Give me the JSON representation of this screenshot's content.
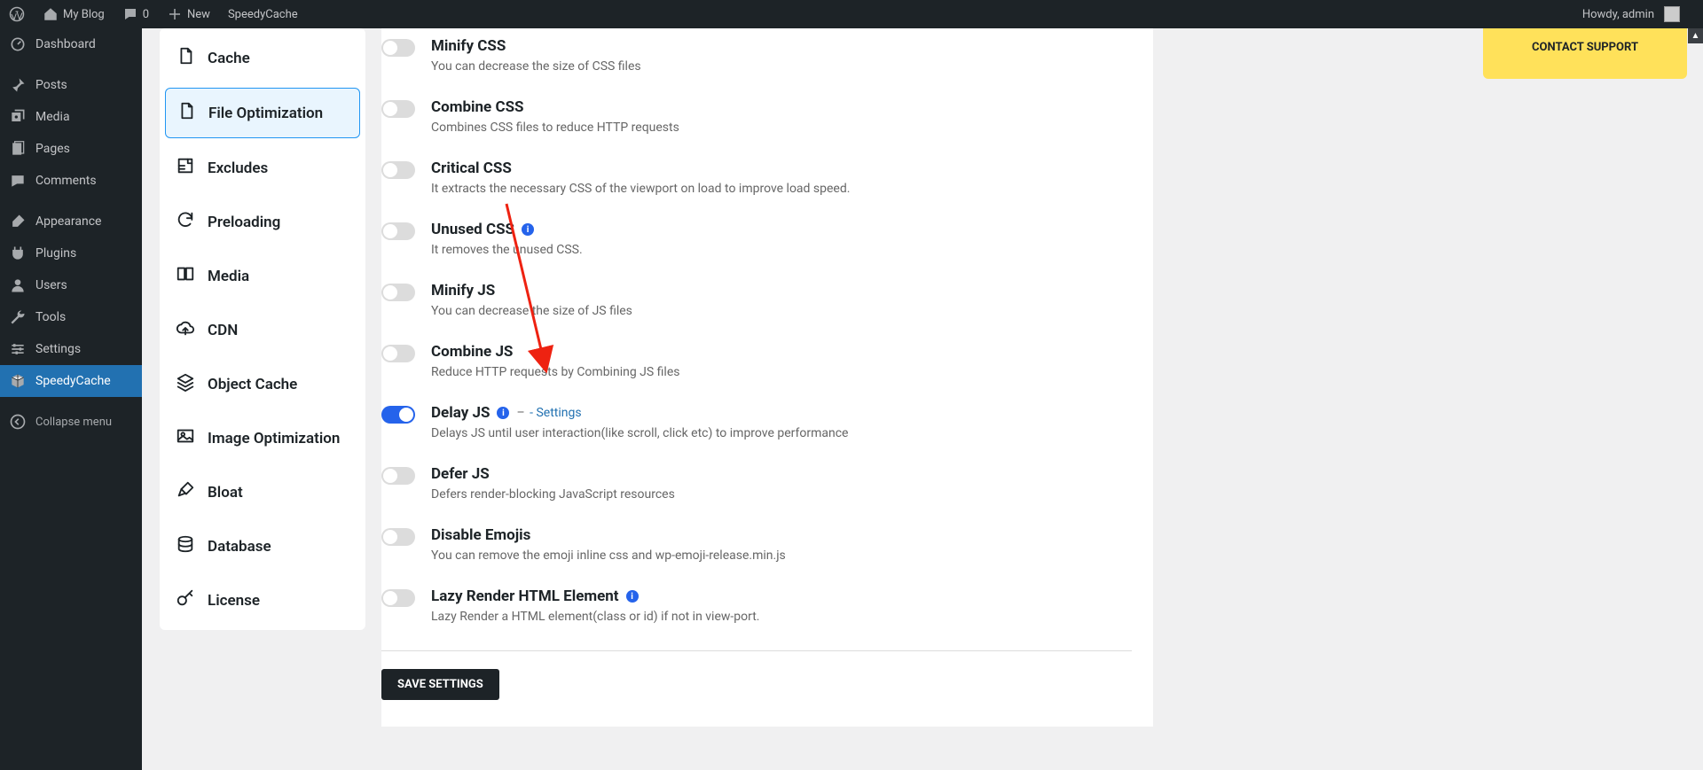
{
  "adminBar": {
    "siteName": "My Blog",
    "comments": "0",
    "new": "New",
    "plugin": "SpeedyCache",
    "greeting": "Howdy, admin"
  },
  "sidebar": {
    "items": [
      {
        "label": "Dashboard",
        "icon": "dashboard"
      },
      {
        "sep": true
      },
      {
        "label": "Posts",
        "icon": "pin"
      },
      {
        "label": "Media",
        "icon": "media"
      },
      {
        "label": "Pages",
        "icon": "pages"
      },
      {
        "label": "Comments",
        "icon": "comment"
      },
      {
        "sep": true
      },
      {
        "label": "Appearance",
        "icon": "brush"
      },
      {
        "label": "Plugins",
        "icon": "plug"
      },
      {
        "label": "Users",
        "icon": "user"
      },
      {
        "label": "Tools",
        "icon": "wrench"
      },
      {
        "label": "Settings",
        "icon": "sliders"
      },
      {
        "label": "SpeedyCache",
        "icon": "cube",
        "active": true
      },
      {
        "sep": true
      }
    ],
    "collapse": "Collapse menu"
  },
  "subnav": {
    "items": [
      {
        "label": "Cache",
        "icon": "file"
      },
      {
        "label": "File Optimization",
        "icon": "file",
        "active": true
      },
      {
        "label": "Excludes",
        "icon": "excludes"
      },
      {
        "label": "Preloading",
        "icon": "refresh"
      },
      {
        "label": "Media",
        "icon": "monitor"
      },
      {
        "label": "CDN",
        "icon": "cloud"
      },
      {
        "label": "Object Cache",
        "icon": "layers"
      },
      {
        "label": "Image Optimization",
        "icon": "image"
      },
      {
        "label": "Bloat",
        "icon": "brush2"
      },
      {
        "label": "Database",
        "icon": "database"
      },
      {
        "label": "License",
        "icon": "key"
      }
    ]
  },
  "settings": {
    "items": [
      {
        "title": "Minify CSS",
        "desc": "You can decrease the size of CSS files",
        "on": false
      },
      {
        "title": "Combine CSS",
        "desc": "Combines CSS files to reduce HTTP requests",
        "on": false
      },
      {
        "title": "Critical CSS",
        "desc": "It extracts the necessary CSS of the viewport on load to improve load speed.",
        "on": false
      },
      {
        "title": "Unused CSS",
        "desc": "It removes the unused CSS.",
        "on": false,
        "info": true
      },
      {
        "title": "Minify JS",
        "desc": "You can decrease the size of JS files",
        "on": false
      },
      {
        "title": "Combine JS",
        "desc": "Reduce HTTP requests by Combining JS files",
        "on": false
      },
      {
        "title": "Delay JS",
        "desc": "Delays JS until user interaction(like scroll, click etc) to improve performance",
        "on": true,
        "info": true,
        "settingsLink": "Settings"
      },
      {
        "title": "Defer JS",
        "desc": "Defers render-blocking JavaScript resources",
        "on": false
      },
      {
        "title": "Disable Emojis",
        "desc": "You can remove the emoji inline css and wp-emoji-release.min.js",
        "on": false
      },
      {
        "title": "Lazy Render HTML Element",
        "desc": "Lazy Render a HTML element(class or id) if not in view-port.",
        "on": false,
        "info": true
      }
    ],
    "save": "SAVE SETTINGS"
  },
  "support": "CONTACT SUPPORT"
}
